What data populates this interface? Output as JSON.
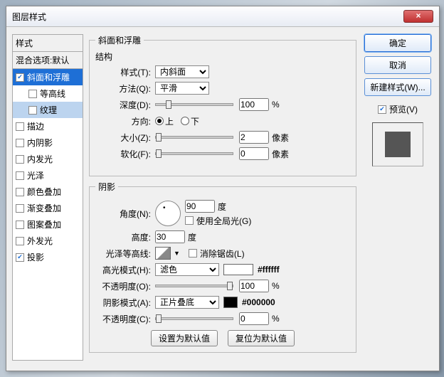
{
  "window": {
    "title": "图层样式",
    "close": "×"
  },
  "styles": {
    "header": "样式",
    "blend": "混合选项:默认",
    "items": [
      {
        "label": "斜面和浮雕",
        "checked": true,
        "sel": "blue"
      },
      {
        "label": "等高线",
        "checked": false,
        "indent": true
      },
      {
        "label": "纹理",
        "checked": false,
        "indent": true,
        "sel": "light"
      },
      {
        "label": "描边",
        "checked": false
      },
      {
        "label": "内阴影",
        "checked": false
      },
      {
        "label": "内发光",
        "checked": false
      },
      {
        "label": "光泽",
        "checked": false
      },
      {
        "label": "颜色叠加",
        "checked": false
      },
      {
        "label": "渐变叠加",
        "checked": false
      },
      {
        "label": "图案叠加",
        "checked": false
      },
      {
        "label": "外发光",
        "checked": false
      },
      {
        "label": "投影",
        "checked": true
      }
    ]
  },
  "bevel": {
    "group": "斜面和浮雕",
    "struct": "结构",
    "style_l": "样式(T):",
    "style_v": "内斜面",
    "tech_l": "方法(Q):",
    "tech_v": "平滑",
    "depth_l": "深度(D):",
    "depth_v": "100",
    "pct": "%",
    "dir_l": "方向:",
    "up": "上",
    "down": "下",
    "size_l": "大小(Z):",
    "size_v": "2",
    "px": "像素",
    "soft_l": "软化(F):",
    "soft_v": "0"
  },
  "shade": {
    "group": "阴影",
    "angle_l": "角度(N):",
    "angle_v": "90",
    "deg": "度",
    "global": "使用全局光(G)",
    "alt_l": "高度:",
    "alt_v": "30",
    "gloss_l": "光泽等高线:",
    "aa": "消除锯齿(L)",
    "hl_mode_l": "高光模式(H):",
    "hl_mode_v": "滤色",
    "hl_hex": "#ffffff",
    "hl_op_l": "不透明度(O):",
    "hl_op_v": "100",
    "sh_mode_l": "阴影模式(A):",
    "sh_mode_v": "正片叠底",
    "sh_hex": "#000000",
    "sh_op_l": "不透明度(C):",
    "sh_op_v": "0"
  },
  "footer": {
    "default": "设置为默认值",
    "reset": "复位为默认值"
  },
  "right": {
    "ok": "确定",
    "cancel": "取消",
    "newstyle": "新建样式(W)...",
    "preview": "预览(V)"
  }
}
